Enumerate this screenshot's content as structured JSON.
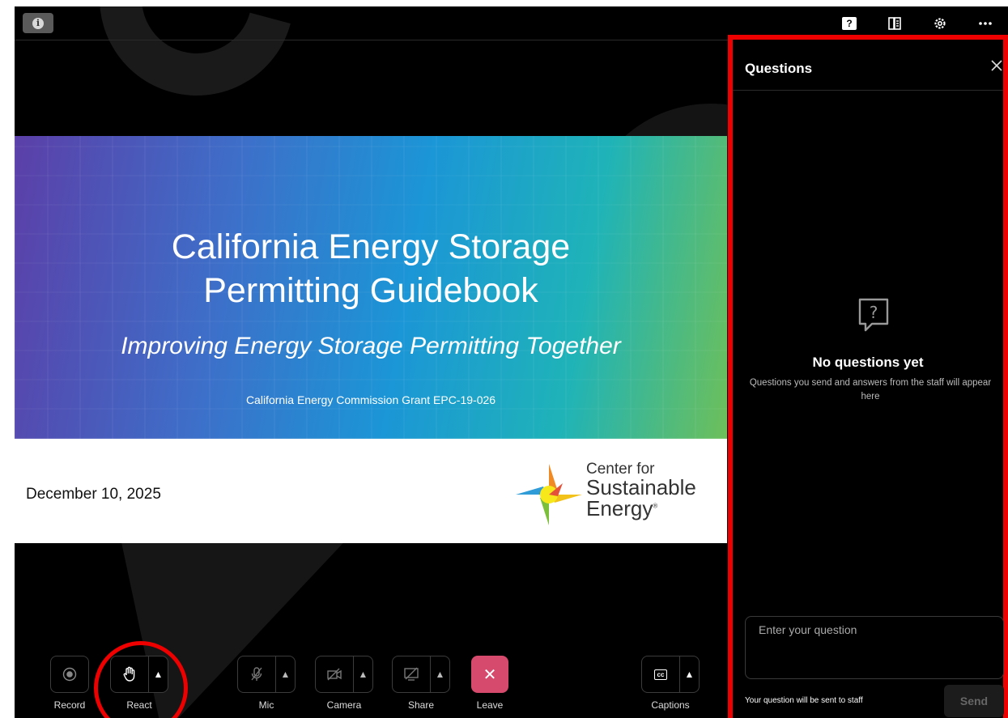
{
  "topbar": {
    "info_icon": "info-icon",
    "icons": [
      "question-icon",
      "notes-icon",
      "gear-icon",
      "more-icon"
    ]
  },
  "slide": {
    "title_line1": "California Energy Storage",
    "title_line2": "Permitting Guidebook",
    "subtitle": "Improving Energy Storage Permitting Together",
    "grant": "California Energy Commission Grant EPC-19-026",
    "date": "December 10, 2025",
    "logo_line1": "Center for",
    "logo_line2": "Sustainable",
    "logo_line3": "Energy",
    "logo_mark": "®"
  },
  "controls": {
    "record": "Record",
    "react": "React",
    "mic": "Mic",
    "camera": "Camera",
    "share": "Share",
    "leave": "Leave",
    "captions": "Captions",
    "captions_icon_text": "cc"
  },
  "questions_panel": {
    "title": "Questions",
    "empty_title": "No questions yet",
    "empty_desc": "Questions you send and answers from the staff will appear here",
    "input_placeholder": "Enter your question",
    "note": "Your question will be sent to staff",
    "send_label": "Send"
  },
  "colors": {
    "leave": "#d64a6d",
    "highlight": "#e00000",
    "background": "#000000"
  }
}
